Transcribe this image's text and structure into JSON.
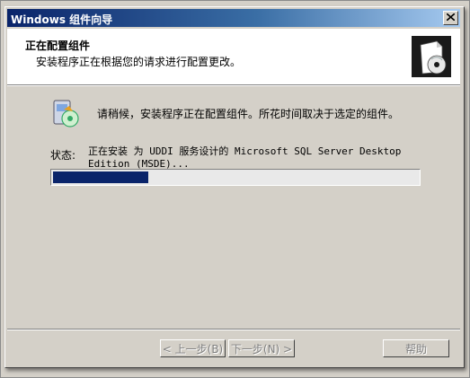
{
  "window": {
    "title": "Windows 组件向导"
  },
  "header": {
    "title": "正在配置组件",
    "subtitle": "安装程序正在根据您的请求进行配置更改。"
  },
  "body": {
    "message": "请稍候，安装程序正在配置组件。所花时间取决于选定的组件。",
    "status_label": "状态:",
    "status_text": "正在安装 为 UDDI 服务设计的 Microsoft SQL Server Desktop Edition (MSDE)...",
    "progress_fraction": 0.26
  },
  "buttons": {
    "back": "< 上一步(B)",
    "next": "下一步(N) >",
    "help": "帮助"
  },
  "colors": {
    "titlebar_start": "#0a246a",
    "titlebar_end": "#a6caf0",
    "progress_fill": "#0a246a",
    "dialog_face": "#d4d0c8"
  }
}
